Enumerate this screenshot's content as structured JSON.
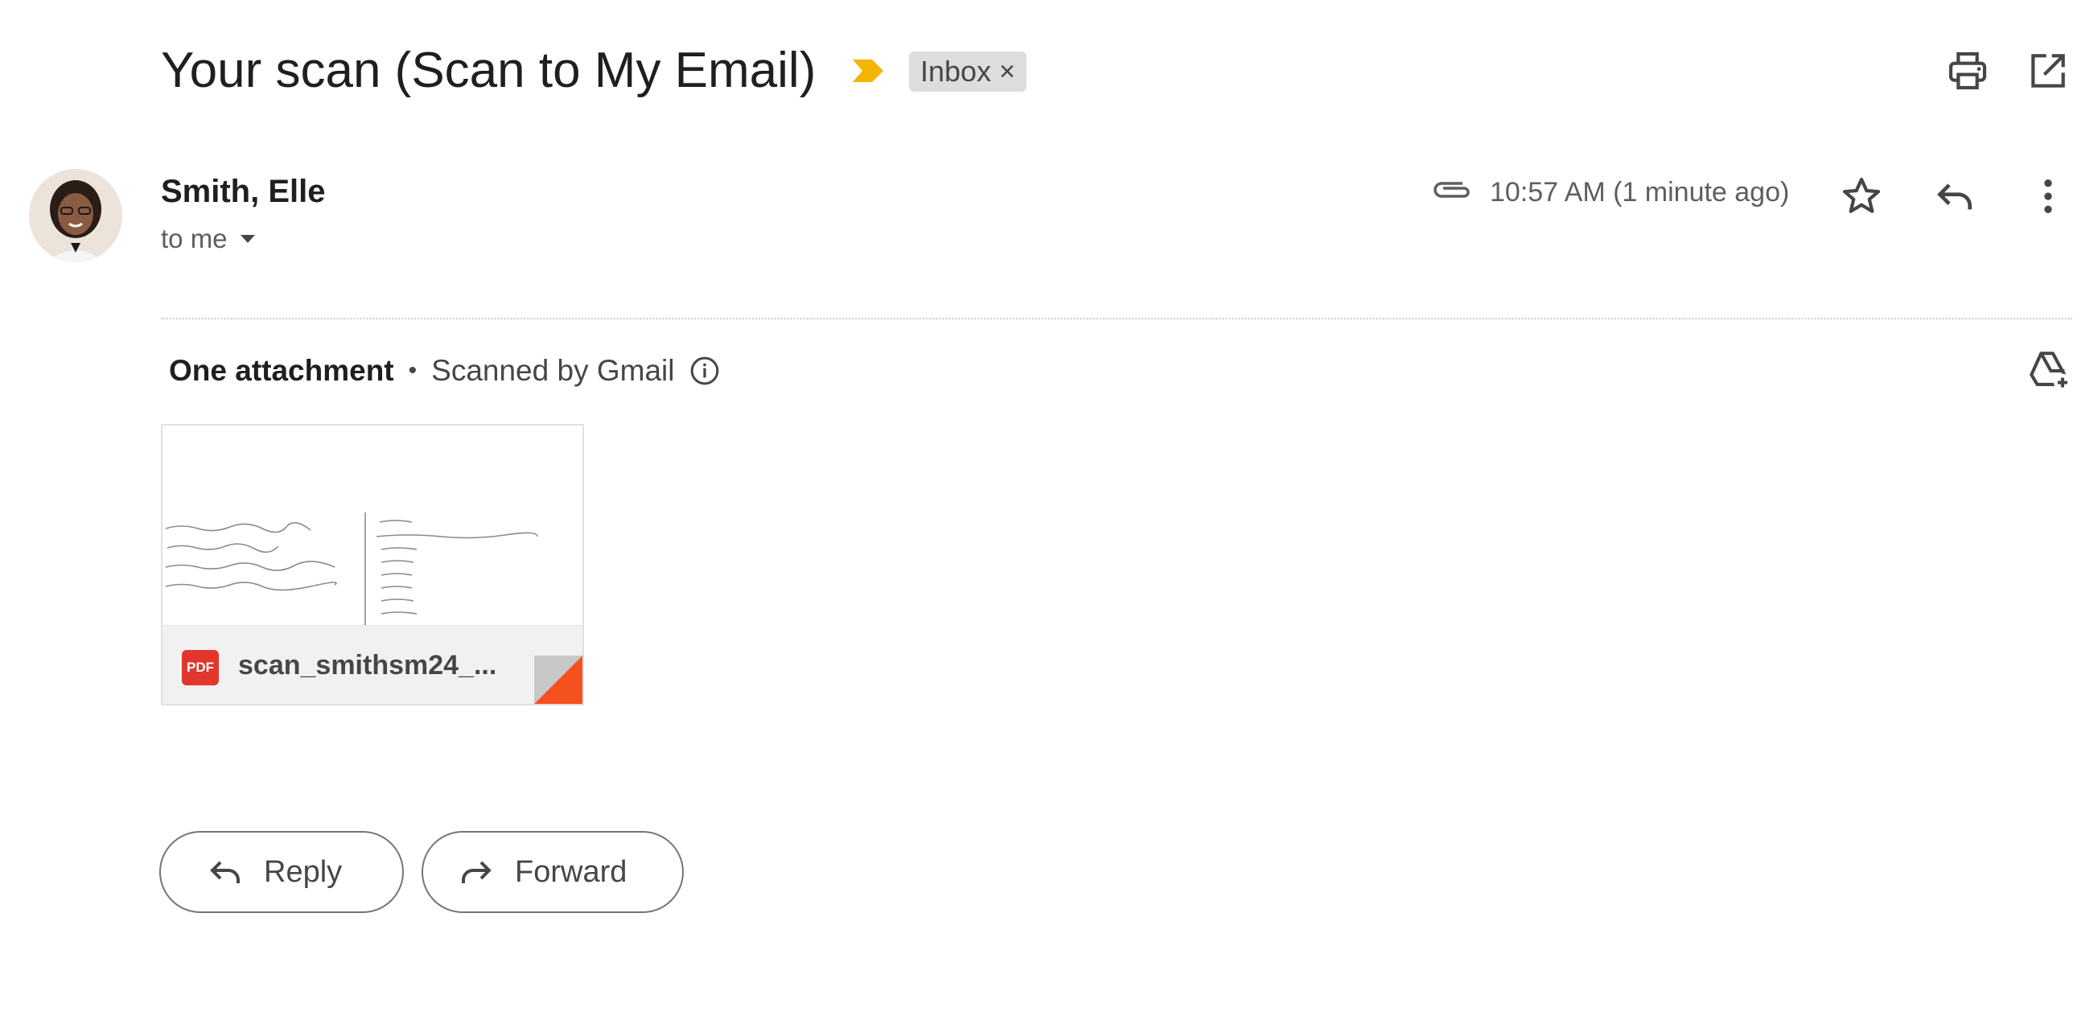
{
  "header": {
    "subject": "Your scan (Scan to My Email)",
    "label": "Inbox",
    "label_remove": "×",
    "importance_color": "#f4b400",
    "icons": [
      "print-icon",
      "open-in-new-window-icon"
    ]
  },
  "message": {
    "sender_name": "Smith, Elle",
    "recipient_text": "to me",
    "timestamp": "10:57 AM (1 minute ago)",
    "icons": [
      "attachment-clip-icon",
      "star-icon",
      "reply-icon",
      "more-vert-icon"
    ]
  },
  "attachments": {
    "count_text": "One attachment",
    "separator": "•",
    "scanned_text": "Scanned by Gmail",
    "files": [
      {
        "type_badge": "PDF",
        "name": "scan_smithsm24_...",
        "badge_color": "#e2352b",
        "corner_color": "#f4511e"
      }
    ],
    "add_to_drive_icon": "add-to-drive-icon"
  },
  "actions": {
    "reply_label": "Reply",
    "forward_label": "Forward"
  }
}
